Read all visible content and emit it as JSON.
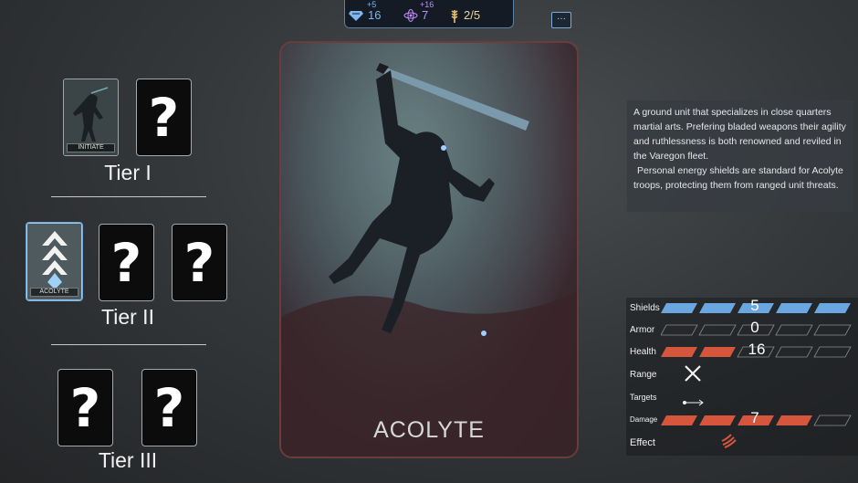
{
  "resources": {
    "crystal": {
      "delta": "+5",
      "value": "16",
      "icon": "crystal-icon"
    },
    "energy": {
      "delta": "+16",
      "value": "7",
      "icon": "atom-icon"
    },
    "supply": {
      "value": "2/5",
      "icon": "wheat-icon"
    }
  },
  "chat_icon": "···",
  "tiers": [
    {
      "label": "Tier I",
      "unit_card": "INITIATE",
      "locked_symbol": "?"
    },
    {
      "label": "Tier II",
      "unit_card": "ACOLYTE",
      "locked_symbol": "?"
    },
    {
      "label": "Tier III",
      "locked_symbol": "?"
    }
  ],
  "main_card": {
    "name": "ACOLYTE"
  },
  "description": {
    "paragraph1": "A ground unit that specializes in close quarters martial arts. Prefering bladed weapons their agility and ruthlessness is both renowned and reviled in the Varegon fleet.",
    "paragraph2": "Personal energy shields are standard for Acolyte troops, protecting them from ranged unit threats."
  },
  "stats": {
    "shields": {
      "label": "Shields",
      "value": "5",
      "filled": 5,
      "max": 5,
      "color": "#6aa7e0"
    },
    "armor": {
      "label": "Armor",
      "value": "0",
      "filled": 0,
      "max": 5
    },
    "health": {
      "label": "Health",
      "value": "16",
      "filled": 2,
      "max": 5,
      "color": "#d5553d"
    },
    "range": {
      "label": "Range",
      "icon": "crossed-swords-icon"
    },
    "targets": {
      "label": "Targets",
      "icon": "arrow-target-icon"
    },
    "damage": {
      "label": "Damage",
      "value": "7",
      "filled": 4,
      "max": 5,
      "color": "#d5553d"
    },
    "effect": {
      "label": "Effect",
      "icon": "claw-icon"
    }
  }
}
